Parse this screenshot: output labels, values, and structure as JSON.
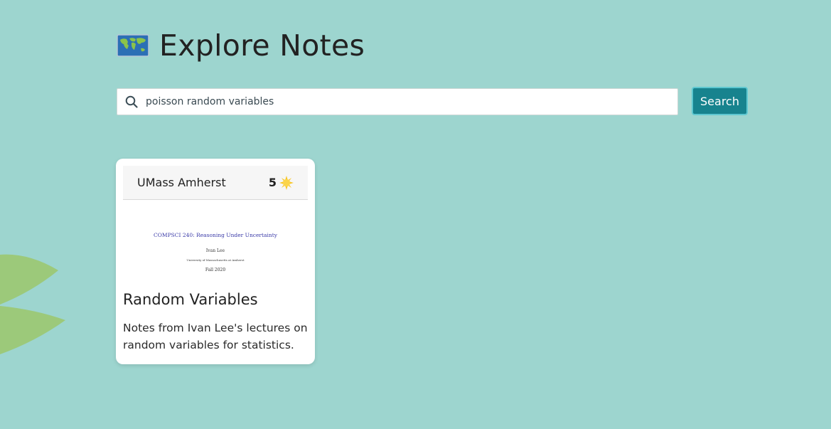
{
  "header": {
    "title": "Explore Notes",
    "icon": "world-map-icon"
  },
  "search": {
    "value": "poisson random variables",
    "placeholder": "",
    "button_label": "Search",
    "icon": "search-icon"
  },
  "results": [
    {
      "school": "UMass Amherst",
      "rating": "5",
      "rating_icon": "sun-icon",
      "preview": {
        "course": "COMPSCI 240: Reasoning Under Uncertainty",
        "author": "Ivan Lee",
        "university": "University of Massachusetts at Amherst",
        "date": "Fall 2020"
      },
      "title": "Random Variables",
      "description": "Notes from Ivan Lee's lectures on random variables for statistics."
    }
  ],
  "colors": {
    "background": "#9dd5cf",
    "accent": "#17838e",
    "leaf": "#9cc97a"
  }
}
